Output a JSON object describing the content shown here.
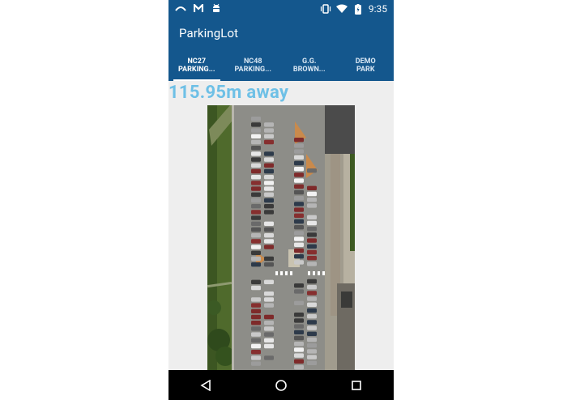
{
  "statusbar": {
    "time": "9:35",
    "battery_level": "charging"
  },
  "app": {
    "title": "ParkingLot"
  },
  "tabs": [
    {
      "line1": "NC27",
      "line2": "PARKING...",
      "active": true
    },
    {
      "line1": "NC48",
      "line2": "PARKING...",
      "active": false
    },
    {
      "line1": "G.G.",
      "line2": "BROWN...",
      "active": false
    },
    {
      "line1": "DEMO",
      "line2": "PARK",
      "active": false
    }
  ],
  "distance": {
    "text": "115.95m away"
  },
  "colors": {
    "primary": "#14578d",
    "distance_text": "#6ec0e6",
    "background": "#eeeeee"
  },
  "icons": {
    "status_left": [
      "cast-icon",
      "gmail-icon",
      "android-icon"
    ],
    "status_right": [
      "vibrate-icon",
      "wifi-icon",
      "battery-icon"
    ],
    "nav": [
      "back-icon",
      "home-icon",
      "recents-icon"
    ]
  }
}
